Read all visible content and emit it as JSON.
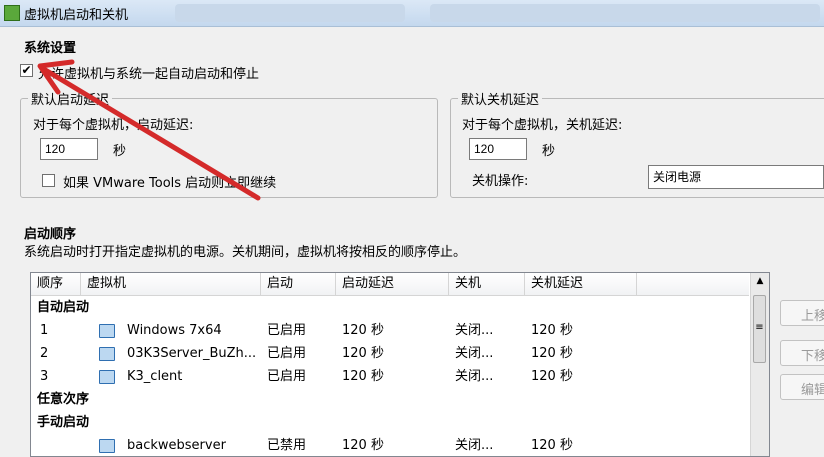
{
  "window": {
    "title": "虚拟机启动和关机"
  },
  "system_settings": {
    "heading": "系统设置",
    "allow_autostart_label": "允许虚拟机与系统一起自动启动和停止",
    "allow_autostart_checked": true
  },
  "default_start_delay": {
    "legend": "默认启动延迟",
    "label": "对于每个虚拟机，启动延迟:",
    "value": "120",
    "unit": "秒",
    "vmware_tools_label": "如果 VMware Tools 启动则立即继续",
    "vmware_tools_checked": false
  },
  "default_stop_delay": {
    "legend": "默认关机延迟",
    "label": "对于每个虚拟机，关机延迟:",
    "value": "120",
    "unit": "秒",
    "shutdown_action_label": "关机操作:",
    "shutdown_action_value": "关闭电源"
  },
  "startup_order": {
    "heading": "启动顺序",
    "description": "系统启动时打开指定虚拟机的电源。关机期间，虚拟机将按相反的顺序停止。",
    "columns": [
      "顺序",
      "虚拟机",
      "启动",
      "启动延迟",
      "关机",
      "关机延迟"
    ],
    "groups": [
      {
        "name": "自动启动",
        "rows": [
          {
            "order": "1",
            "vm": "Windows 7x64",
            "startup": "已启用",
            "start_delay": "120 秒",
            "shutdown": "关闭...",
            "stop_delay": "120 秒"
          },
          {
            "order": "2",
            "vm": "03K3Server_BuZh...",
            "startup": "已启用",
            "start_delay": "120 秒",
            "shutdown": "关闭...",
            "stop_delay": "120 秒"
          },
          {
            "order": "3",
            "vm": "K3_clent",
            "startup": "已启用",
            "start_delay": "120 秒",
            "shutdown": "关闭...",
            "stop_delay": "120 秒"
          }
        ]
      },
      {
        "name": "任意次序",
        "rows": []
      },
      {
        "name": "手动启动",
        "rows": [
          {
            "order": "",
            "vm": "backwebserver",
            "startup": "已禁用",
            "start_delay": "120 秒",
            "shutdown": "关闭...",
            "stop_delay": "120 秒"
          }
        ]
      }
    ]
  },
  "side_buttons": {
    "move_up": "上移",
    "move_down": "下移",
    "edit": "编辑"
  },
  "colors": {
    "annotation_arrow": "#d42a2a"
  }
}
